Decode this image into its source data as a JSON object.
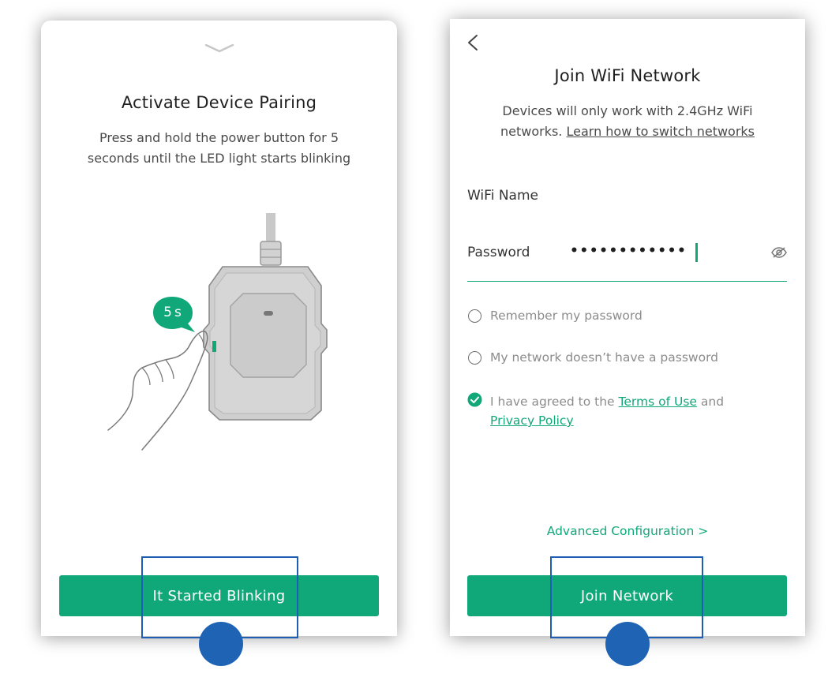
{
  "pairing_screen": {
    "title": "Activate Device Pairing",
    "description_line1": "Press and hold the power button for 5",
    "description_line2": "seconds until the LED light starts blinking",
    "timer_badge": "5s",
    "button_label": "It Started Blinking"
  },
  "wifi_screen": {
    "title": "Join WiFi Network",
    "note_line1": "Devices will only work with 2.4GHz WiFi",
    "note_line2_prefix": "networks.",
    "learn_link": "Learn how to switch networks",
    "wifi_name_label": "WiFi Name",
    "password_label": "Password",
    "password_value": "••••••••••••",
    "remember_label": "Remember my password",
    "no_password_label": "My network doesn’t have a password",
    "agree_prefix": "I have agreed to the",
    "terms_link": "Terms of Use",
    "agree_and": "and",
    "privacy_link": "Privacy Policy",
    "advanced_label": "Advanced Configuration >",
    "button_label": "Join Network",
    "remember_checked": false,
    "no_password_checked": false,
    "agreed_checked": true
  },
  "colors": {
    "accent": "#10a878",
    "highlight": "#1f5eb5"
  },
  "icons": [
    "chevron-down-icon",
    "back-arrow-icon",
    "eye-off-icon",
    "checkmark-icon"
  ]
}
